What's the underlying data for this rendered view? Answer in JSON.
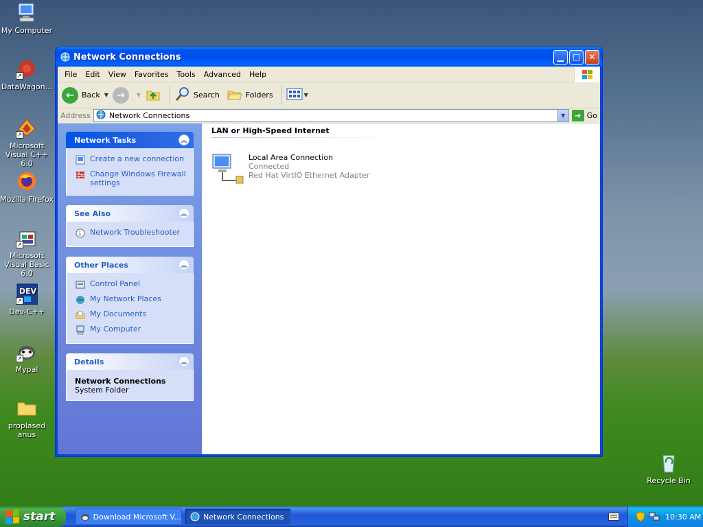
{
  "desktop": {
    "icons": [
      {
        "label": "My Computer",
        "icon": "my-computer-icon"
      },
      {
        "label": "DataWagon...",
        "icon": "datawagon-icon"
      },
      {
        "label": "Microsoft Visual C++ 6.0",
        "icon": "visual-cpp-icon"
      },
      {
        "label": "Mozilla Firefox",
        "icon": "firefox-icon"
      },
      {
        "label": "Microsoft Visual Basic 6.0",
        "icon": "visual-basic-icon"
      },
      {
        "label": "Dev-C++",
        "icon": "devcpp-icon"
      },
      {
        "label": "Mypal",
        "icon": "mypal-icon"
      },
      {
        "label": "proplased anus",
        "icon": "folder-icon"
      },
      {
        "label": "Recycle Bin",
        "icon": "recycle-bin-icon"
      }
    ]
  },
  "window": {
    "title": "Network Connections",
    "menu": [
      "File",
      "Edit",
      "View",
      "Favorites",
      "Tools",
      "Advanced",
      "Help"
    ],
    "toolbar": {
      "back": "Back",
      "search": "Search",
      "folders": "Folders"
    },
    "address": {
      "label": "Address",
      "value": "Network Connections",
      "go": "Go"
    },
    "taskpane": {
      "network_tasks": {
        "title": "Network Tasks",
        "items": [
          "Create a new connection",
          "Change Windows Firewall settings"
        ]
      },
      "see_also": {
        "title": "See Also",
        "items": [
          "Network Troubleshooter"
        ]
      },
      "other_places": {
        "title": "Other Places",
        "items": [
          "Control Panel",
          "My Network Places",
          "My Documents",
          "My Computer"
        ]
      },
      "details": {
        "title": "Details",
        "name": "Network Connections",
        "type": "System Folder"
      }
    },
    "main": {
      "group": "LAN or High-Speed Internet",
      "connection": {
        "name": "Local Area Connection",
        "status": "Connected",
        "device": "Red Hat VirtIO Ethernet Adapter"
      }
    }
  },
  "taskbar": {
    "start": "start",
    "buttons": [
      "Download Microsoft V...",
      "Network Connections"
    ],
    "clock": "10:30 AM"
  },
  "colors": {
    "title_blue": "#0053ee",
    "link_blue": "#215dc6",
    "start_green": "#3c9a3c"
  }
}
